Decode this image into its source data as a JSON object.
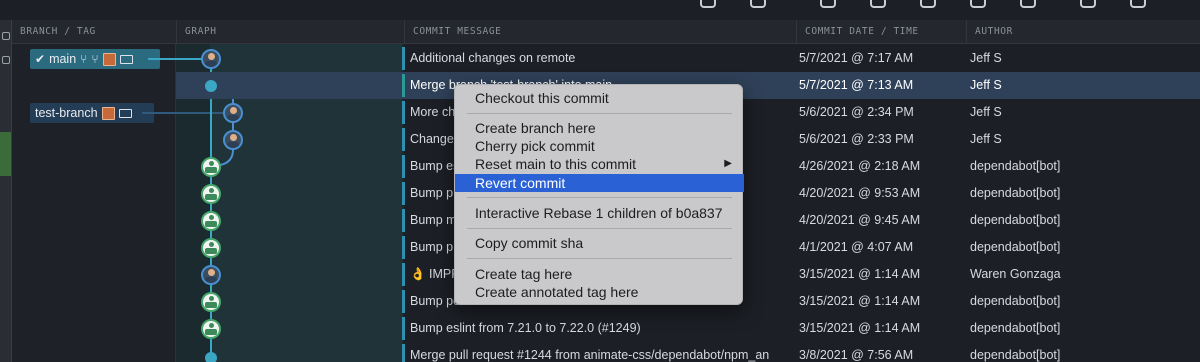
{
  "header": {
    "col_branch": "BRANCH / TAG",
    "col_graph": "GRAPH",
    "col_message": "COMMIT MESSAGE",
    "col_date": "COMMIT DATE / TIME",
    "col_author": "AUTHOR"
  },
  "branches": {
    "main_label": "main",
    "test_label": "test-branch"
  },
  "rows": [
    {
      "message": "Additional changes on remote",
      "date": "5/7/2021 @ 7:17 AM",
      "author": "Jeff S"
    },
    {
      "message": "Merge branch 'test-branch' into main",
      "date": "5/7/2021 @ 7:13 AM",
      "author": "Jeff S"
    },
    {
      "message": "More ch",
      "date": "5/6/2021 @ 2:34 PM",
      "author": "Jeff S"
    },
    {
      "message": "Changes",
      "date": "5/6/2021 @ 2:33 PM",
      "author": "Jeff S"
    },
    {
      "message": "Bump es",
      "date": "4/26/2021 @ 2:18 AM",
      "author": "dependabot[bot]"
    },
    {
      "message": "Bump p",
      "date": "4/20/2021 @ 9:53 AM",
      "author": "dependabot[bot]"
    },
    {
      "message": "Bump m",
      "date": "4/20/2021 @ 9:45 AM",
      "author": "dependabot[bot]"
    },
    {
      "message": "Bump p",
      "date": "4/1/2021 @ 4:07 AM",
      "author": "dependabot[bot]"
    },
    {
      "message": "👌 IMPR",
      "date": "3/15/2021 @ 1:14 AM",
      "author": "Waren Gonzaga"
    },
    {
      "message": "Bump po",
      "date": "3/15/2021 @ 1:14 AM",
      "author": "dependabot[bot]"
    },
    {
      "message": "Bump eslint from 7.21.0 to 7.22.0 (#1249)",
      "date": "3/15/2021 @ 1:14 AM",
      "author": "dependabot[bot]"
    },
    {
      "message": "Merge pull request #1244 from animate-css/dependabot/npm_an",
      "date": "3/8/2021 @ 7:56 AM",
      "author": "dependabot[bot]"
    }
  ],
  "context_menu": {
    "checkout": "Checkout this commit",
    "create_branch": "Create branch here",
    "cherry_pick": "Cherry pick commit",
    "reset": "Reset main to this commit",
    "revert": "Revert commit",
    "interactive_rebase": "Interactive Rebase 1 children of b0a837",
    "copy_sha": "Copy commit sha",
    "create_tag": "Create tag here",
    "create_annotated_tag": "Create annotated tag here"
  }
}
